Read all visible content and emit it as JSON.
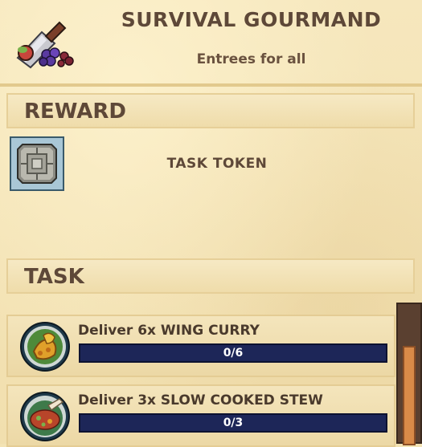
{
  "task": {
    "title": "SURVIVAL GOURMAND",
    "subtitle": "Entrees for all",
    "icon": "cleaver-and-grapes-icon"
  },
  "reward": {
    "heading": "REWARD",
    "item_label": "TASK TOKEN",
    "item_icon": "task-token-icon"
  },
  "objectives": {
    "heading": "TASK",
    "items": [
      {
        "label": "Deliver 6x WING CURRY",
        "progress_text": "0/6",
        "progress": 0,
        "icon": "wing-curry-icon"
      },
      {
        "label": "Deliver 3x SLOW COOKED STEW",
        "progress_text": "0/3",
        "progress": 0,
        "icon": "slow-cooked-stew-icon"
      }
    ]
  },
  "colors": {
    "parchment": "#f3e3b4",
    "text": "#5e4838",
    "progress_bar": "#1d2658"
  }
}
